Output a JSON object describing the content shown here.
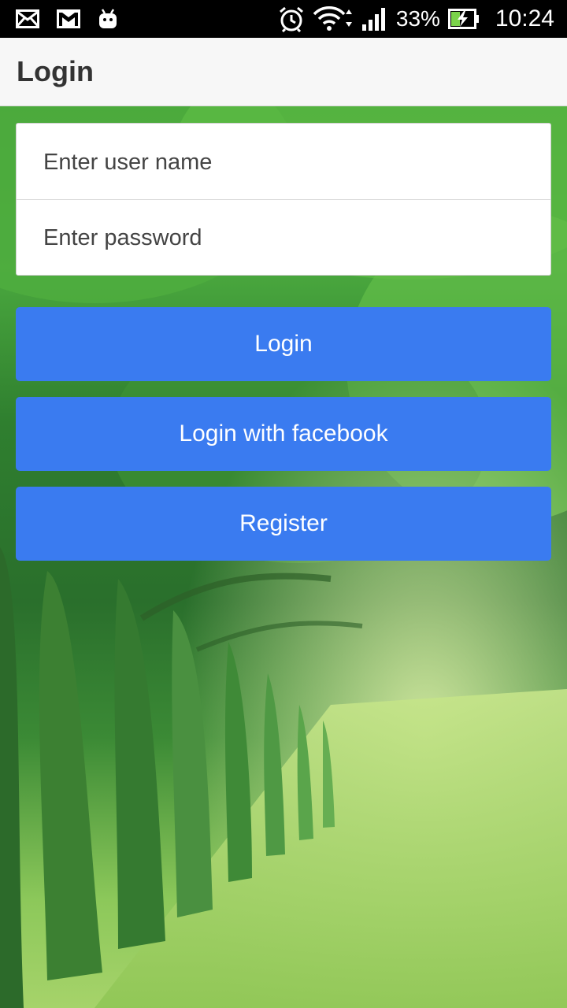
{
  "status_bar": {
    "battery_percent": "33%",
    "time": "10:24",
    "icons": [
      "mail-icon",
      "gmail-icon",
      "android-icon",
      "alarm-icon",
      "wifi-icon",
      "signal-icon",
      "battery-charging-icon"
    ]
  },
  "app_bar": {
    "title": "Login"
  },
  "form": {
    "username_placeholder": "Enter user name",
    "password_placeholder": "Enter password"
  },
  "buttons": {
    "login": "Login",
    "facebook": "Login with facebook",
    "register": "Register"
  },
  "colors": {
    "button": "#3a7bf0",
    "app_bar": "#f7f7f7",
    "status_bar": "#000000"
  }
}
